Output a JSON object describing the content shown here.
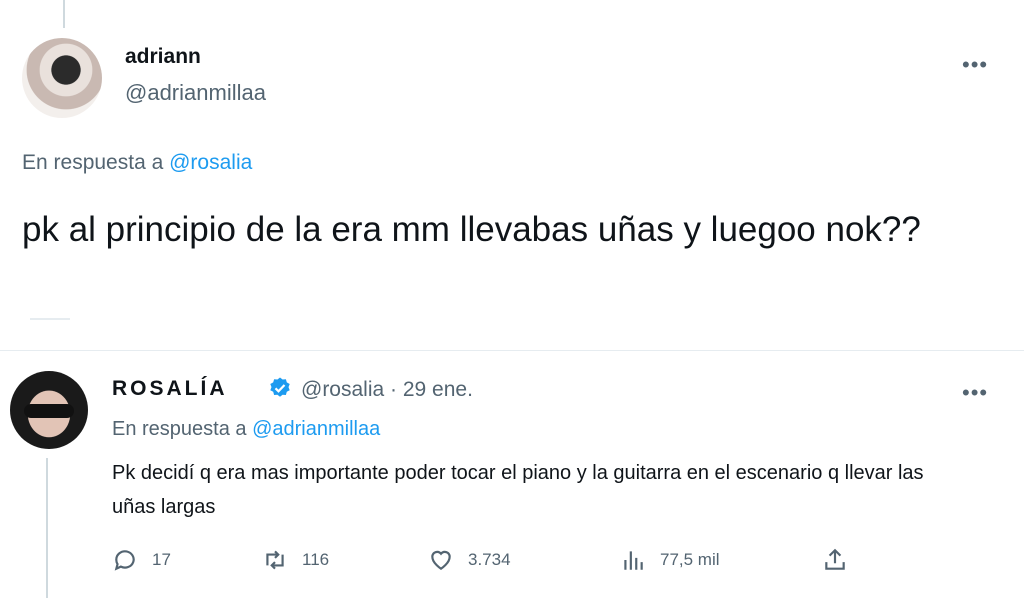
{
  "tweet1": {
    "name": "adriann",
    "handle": "@adrianmillaa",
    "replying_prefix": "En respuesta a",
    "replying_mention": "@rosalia",
    "text": "pk al principio de la era mm llevabas uñas y luegoo nok??"
  },
  "tweet2": {
    "name": "ROSALÍA",
    "handle_date": "@rosalia · 29 ene.",
    "replying_prefix": "En respuesta a",
    "replying_mention": "@adrianmillaa",
    "text": "Pk decidí q era mas importante poder tocar el piano y la guitarra en el escenario q llevar las uñas largas",
    "stats": {
      "replies": "17",
      "retweets": "116",
      "likes": "3.734",
      "views": "77,5 mil"
    }
  },
  "colors": {
    "accent": "#1d9bf0",
    "secondary_text": "#536471",
    "primary_text": "#0f1419"
  },
  "icons": [
    "more-icon",
    "verified-icon",
    "reply-icon",
    "retweet-icon",
    "like-icon",
    "views-icon",
    "share-icon"
  ]
}
